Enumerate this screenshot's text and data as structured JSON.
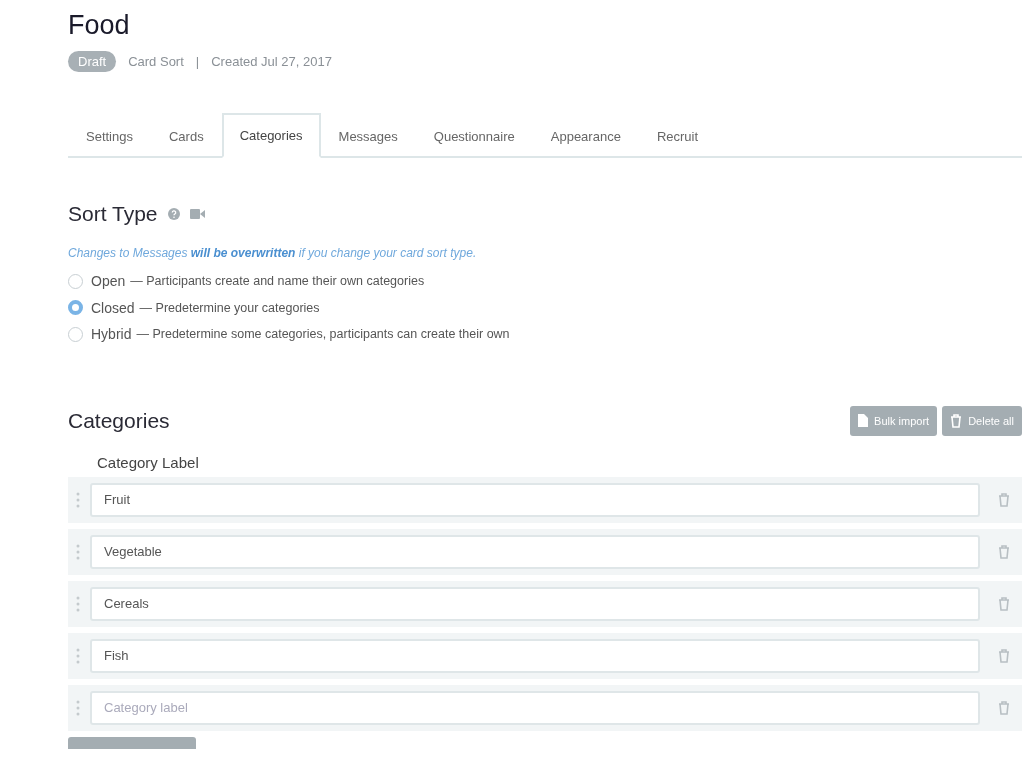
{
  "title": "Food",
  "status_badge": "Draft",
  "study_type": "Card Sort",
  "separator": "|",
  "created": "Created Jul 27, 2017",
  "tabs": [
    {
      "label": "Settings",
      "selected": false
    },
    {
      "label": "Cards",
      "selected": false
    },
    {
      "label": "Categories",
      "selected": true
    },
    {
      "label": "Messages",
      "selected": false
    },
    {
      "label": "Questionnaire",
      "selected": false
    },
    {
      "label": "Appearance",
      "selected": false
    },
    {
      "label": "Recruit",
      "selected": false
    }
  ],
  "sort_type": {
    "heading": "Sort Type",
    "notice": "Changes to Messages **will be overwritten** if you change your card sort type.",
    "options": [
      {
        "label": "Open",
        "description": "— Participants create and name their own categories",
        "selected": false
      },
      {
        "label": "Closed",
        "description": "— Predetermine your categories",
        "selected": true
      },
      {
        "label": "Hybrid",
        "description": "— Predetermine some categories, participants can create their own",
        "selected": false
      }
    ]
  },
  "categories": {
    "heading": "Categories",
    "buttons": [
      {
        "label": "Bulk import",
        "kind": "import"
      },
      {
        "label": "Delete all",
        "kind": "delete"
      }
    ],
    "column_label": "Category Label",
    "rows": [
      {
        "value": "Fruit"
      },
      {
        "value": "Vegetable"
      },
      {
        "value": "Cereals"
      },
      {
        "value": "Fish"
      },
      {
        "placeholder": "Category label"
      }
    ]
  }
}
